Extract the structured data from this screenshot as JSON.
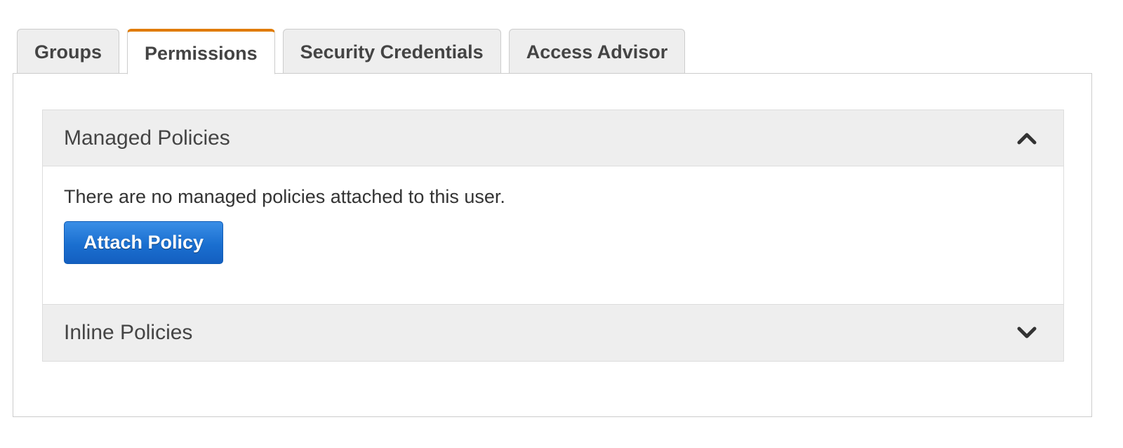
{
  "tabs": [
    {
      "label": "Groups",
      "active": false
    },
    {
      "label": "Permissions",
      "active": true
    },
    {
      "label": "Security Credentials",
      "active": false
    },
    {
      "label": "Access Advisor",
      "active": false
    }
  ],
  "managed_policies": {
    "title": "Managed Policies",
    "state": "expanded",
    "icon": "chevron-up-icon",
    "message": "There are no managed policies attached to this user.",
    "attach_button": "Attach Policy"
  },
  "inline_policies": {
    "title": "Inline Policies",
    "state": "collapsed",
    "icon": "chevron-down-icon"
  },
  "colors": {
    "active_tab_accent": "#e07b00",
    "primary_button": "#1a6fd0"
  }
}
